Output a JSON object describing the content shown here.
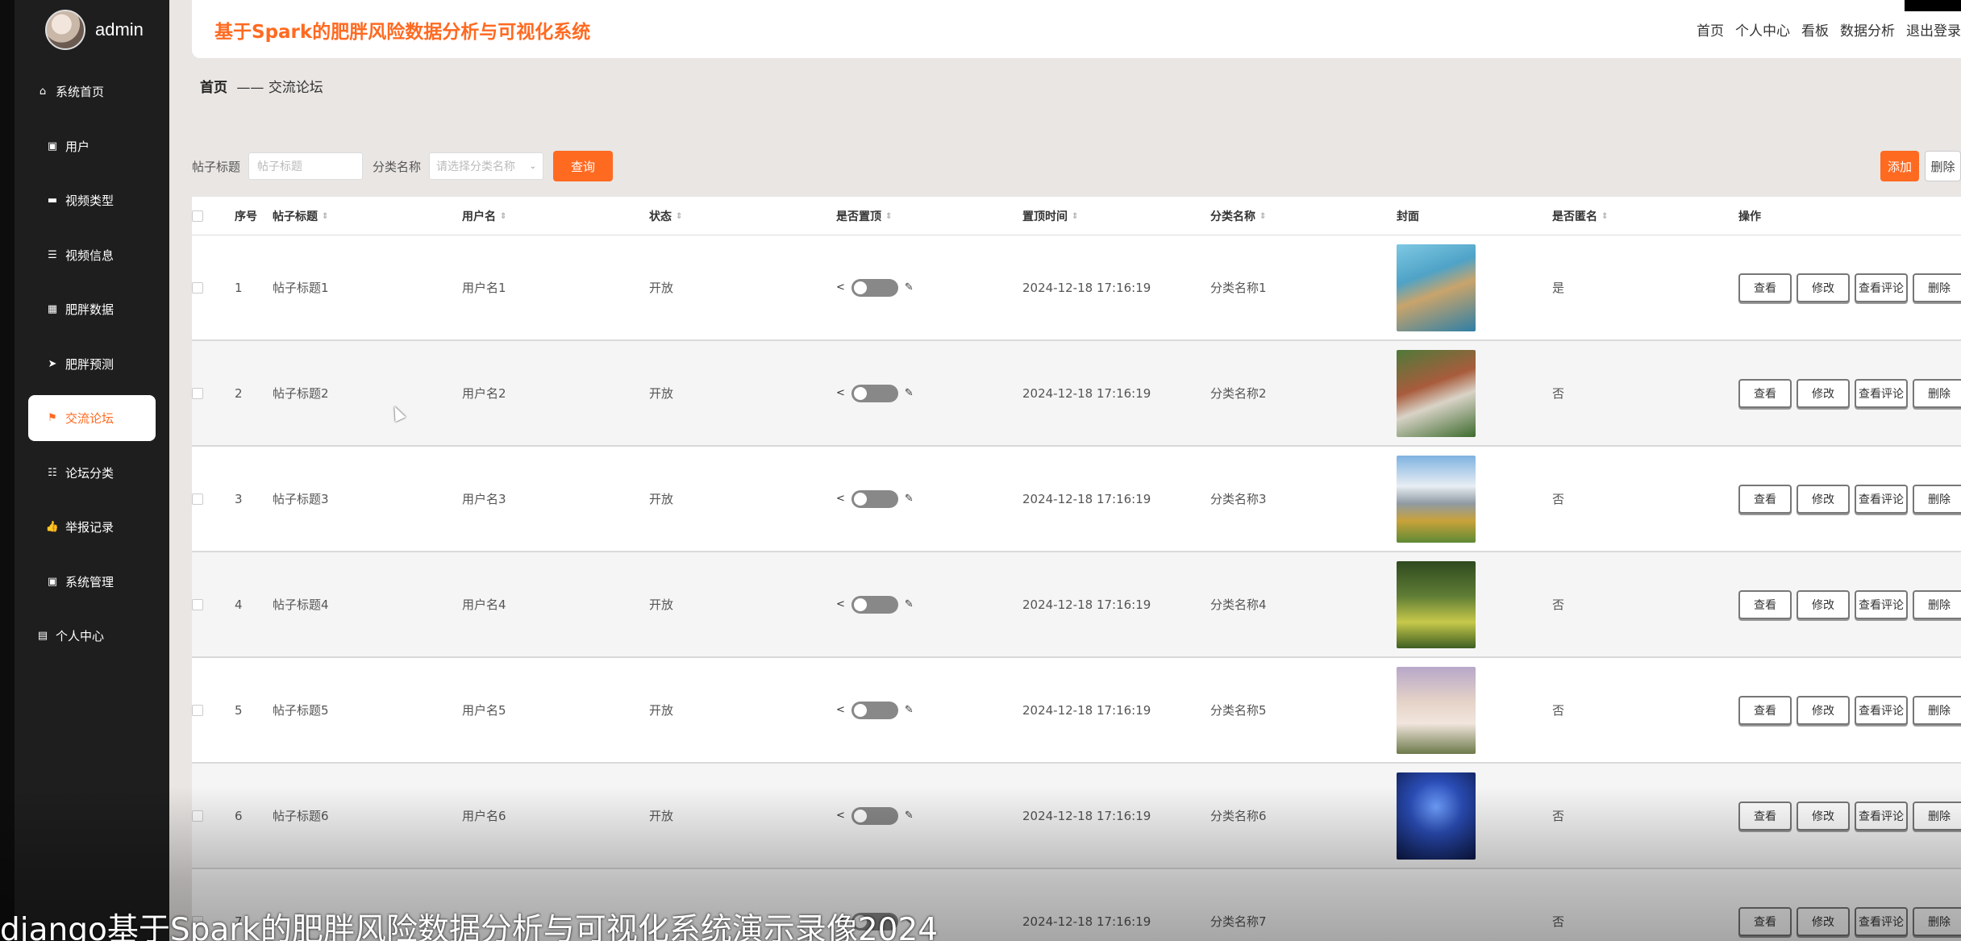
{
  "sidebar": {
    "username": "admin",
    "items": [
      {
        "icon": "home-icon",
        "label": "系统首页"
      },
      {
        "icon": "clipboard-icon",
        "label": "用户"
      },
      {
        "icon": "film-icon",
        "label": "视频类型"
      },
      {
        "icon": "list-icon",
        "label": "视频信息"
      },
      {
        "icon": "grid-icon",
        "label": "肥胖数据"
      },
      {
        "icon": "send-icon",
        "label": "肥胖预测"
      },
      {
        "icon": "flag-icon",
        "label": "交流论坛",
        "active": true
      },
      {
        "icon": "sliders-icon",
        "label": "论坛分类"
      },
      {
        "icon": "thumbs-icon",
        "label": "举报记录"
      },
      {
        "icon": "clipboard-icon",
        "label": "系统管理"
      },
      {
        "icon": "calendar-icon",
        "label": "个人中心"
      }
    ]
  },
  "header": {
    "title": "基于Spark的肥胖风险数据分析与可视化系统",
    "nav": [
      "首页",
      "个人中心",
      "看板",
      "数据分析",
      "退出登录"
    ]
  },
  "breadcrumb": {
    "home": "首页",
    "separator": "——",
    "current": "交流论坛"
  },
  "search": {
    "title_label": "帖子标题",
    "title_placeholder": "帖子标题",
    "category_label": "分类名称",
    "category_placeholder": "请选择分类名称",
    "query_label": "查询"
  },
  "actions": {
    "add_label": "添加",
    "delete_label": "删除"
  },
  "table": {
    "headers": [
      "序号",
      "帖子标题",
      "用户名",
      "状态",
      "是否置顶",
      "置顶时间",
      "分类名称",
      "封面",
      "是否匿名",
      "操作"
    ],
    "row_actions": [
      "查看",
      "修改",
      "查看评论",
      "删除"
    ],
    "rows": [
      {
        "no": "1",
        "title": "帖子标题1",
        "user": "用户名1",
        "status": "开放",
        "time": "2024-12-18 17:16:19",
        "category": "分类名称1",
        "anon": "是"
      },
      {
        "no": "2",
        "title": "帖子标题2",
        "user": "用户名2",
        "status": "开放",
        "time": "2024-12-18 17:16:19",
        "category": "分类名称2",
        "anon": "否"
      },
      {
        "no": "3",
        "title": "帖子标题3",
        "user": "用户名3",
        "status": "开放",
        "time": "2024-12-18 17:16:19",
        "category": "分类名称3",
        "anon": "否"
      },
      {
        "no": "4",
        "title": "帖子标题4",
        "user": "用户名4",
        "status": "开放",
        "time": "2024-12-18 17:16:19",
        "category": "分类名称4",
        "anon": "否"
      },
      {
        "no": "5",
        "title": "帖子标题5",
        "user": "用户名5",
        "status": "开放",
        "time": "2024-12-18 17:16:19",
        "category": "分类名称5",
        "anon": "否"
      },
      {
        "no": "6",
        "title": "帖子标题6",
        "user": "用户名6",
        "status": "开放",
        "time": "2024-12-18 17:16:19",
        "category": "分类名称6",
        "anon": "否"
      },
      {
        "no": "7",
        "title": "",
        "user": "",
        "status": "",
        "time": "2024-12-18 17:16:19",
        "category": "分类名称7",
        "anon": "否"
      }
    ]
  },
  "caption": "django基于Spark的肥胖风险数据分析与可视化系统演示录像2024",
  "colors": {
    "accent": "#ff6a21",
    "sidebar_bg": "#1e1e1e",
    "main_bg": "#e9e6e4"
  }
}
